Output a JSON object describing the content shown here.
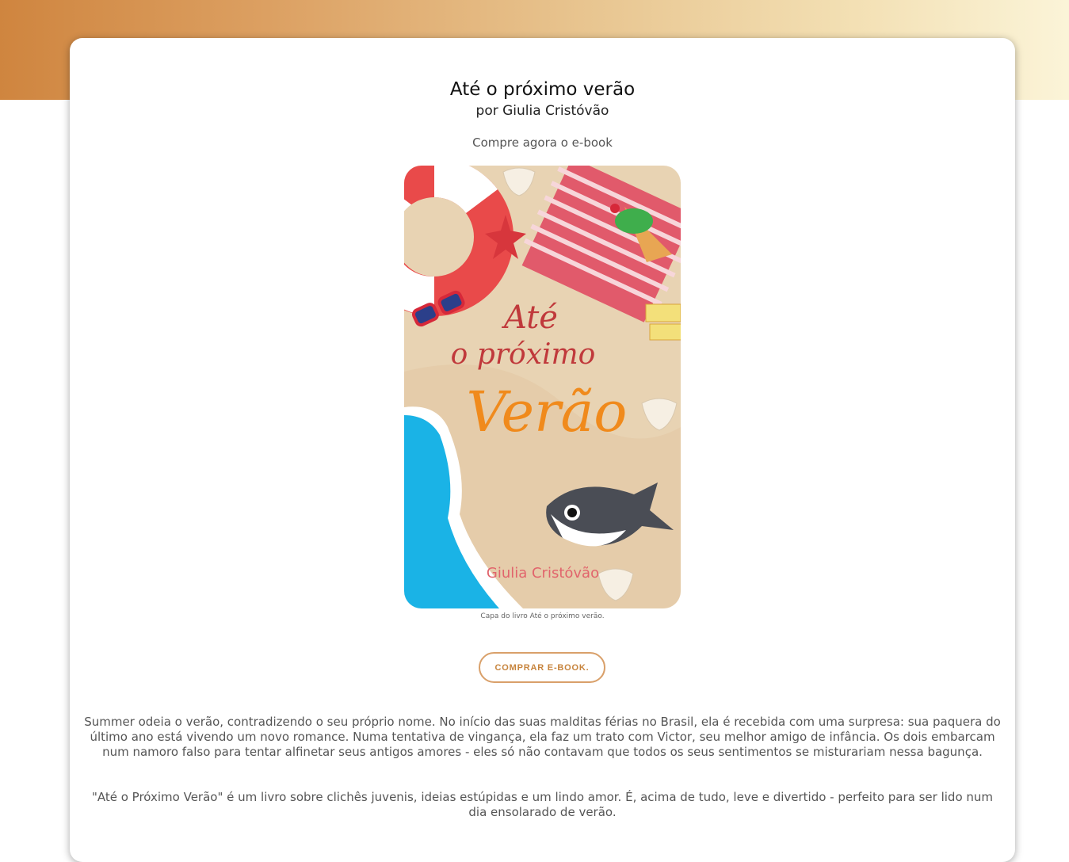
{
  "book": {
    "title": "Até o próximo verão",
    "author_line": "por Giulia Cristóvão",
    "subtitle": "Compre agora o e-book",
    "cover_caption": "Capa do livro Até o próximo verão.",
    "buy_button": "COMPRAR E-BOOK.",
    "cover_title_top": "Até",
    "cover_title_mid": "o próximo",
    "cover_title_big": "Verão",
    "cover_author": "Giulia Cristóvão"
  },
  "description": {
    "p1": "Summer odeia o verão, contradizendo o seu próprio nome. No início das suas malditas férias no Brasil, ela é recebida com uma surpresa: sua paquera do último ano está vivendo um novo romance. Numa tentativa de vingança, ela faz um trato com Victor, seu melhor amigo de infância. Os dois embarcam num namoro falso para tentar alfinetar seus antigos amores - eles só não contavam que todos os seus sentimentos se misturariam nessa bagunça.",
    "p2": "\"Até o Próximo Verão\" é um livro sobre clichês juvenis, ideias estúpidas e um lindo amor. É, acima de tudo, leve e divertido - perfeito para ser lido num dia ensolarado de verão."
  },
  "colors": {
    "accent": "#c7843d",
    "gradient_start": "#cf853f",
    "gradient_end": "#fbf4d8"
  }
}
